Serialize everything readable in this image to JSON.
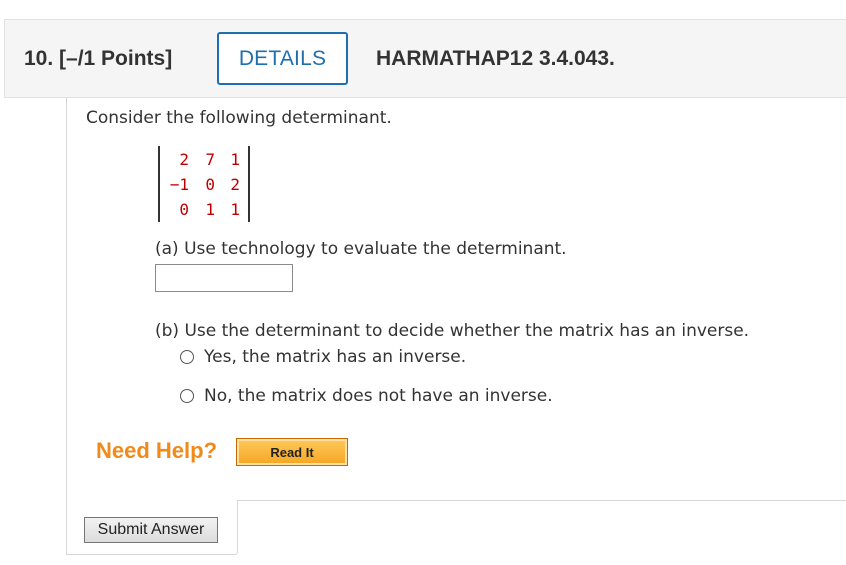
{
  "question": {
    "number_points": "10.  [–/1 Points]",
    "details_label": "DETAILS",
    "code": "HARMATHAP12 3.4.043."
  },
  "prompt": "Consider the following determinant.",
  "determinant": {
    "rows": [
      [
        "2",
        "7",
        "1"
      ],
      [
        "−1",
        "0",
        "2"
      ],
      [
        "0",
        "1",
        "1"
      ]
    ],
    "color": "#c00000"
  },
  "part_a": {
    "text": "(a) Use technology to evaluate the determinant.",
    "answer_value": "",
    "answer_placeholder": ""
  },
  "part_b": {
    "text": "(b) Use the determinant to decide whether the matrix has an inverse.",
    "options": [
      "Yes, the matrix has an inverse.",
      "No, the matrix does not have an inverse."
    ]
  },
  "help": {
    "label": "Need Help?",
    "read_it": "Read It",
    "label_color": "#f08a1a"
  },
  "submit_label": "Submit Answer",
  "colors": {
    "accent": "#1e6fae"
  }
}
